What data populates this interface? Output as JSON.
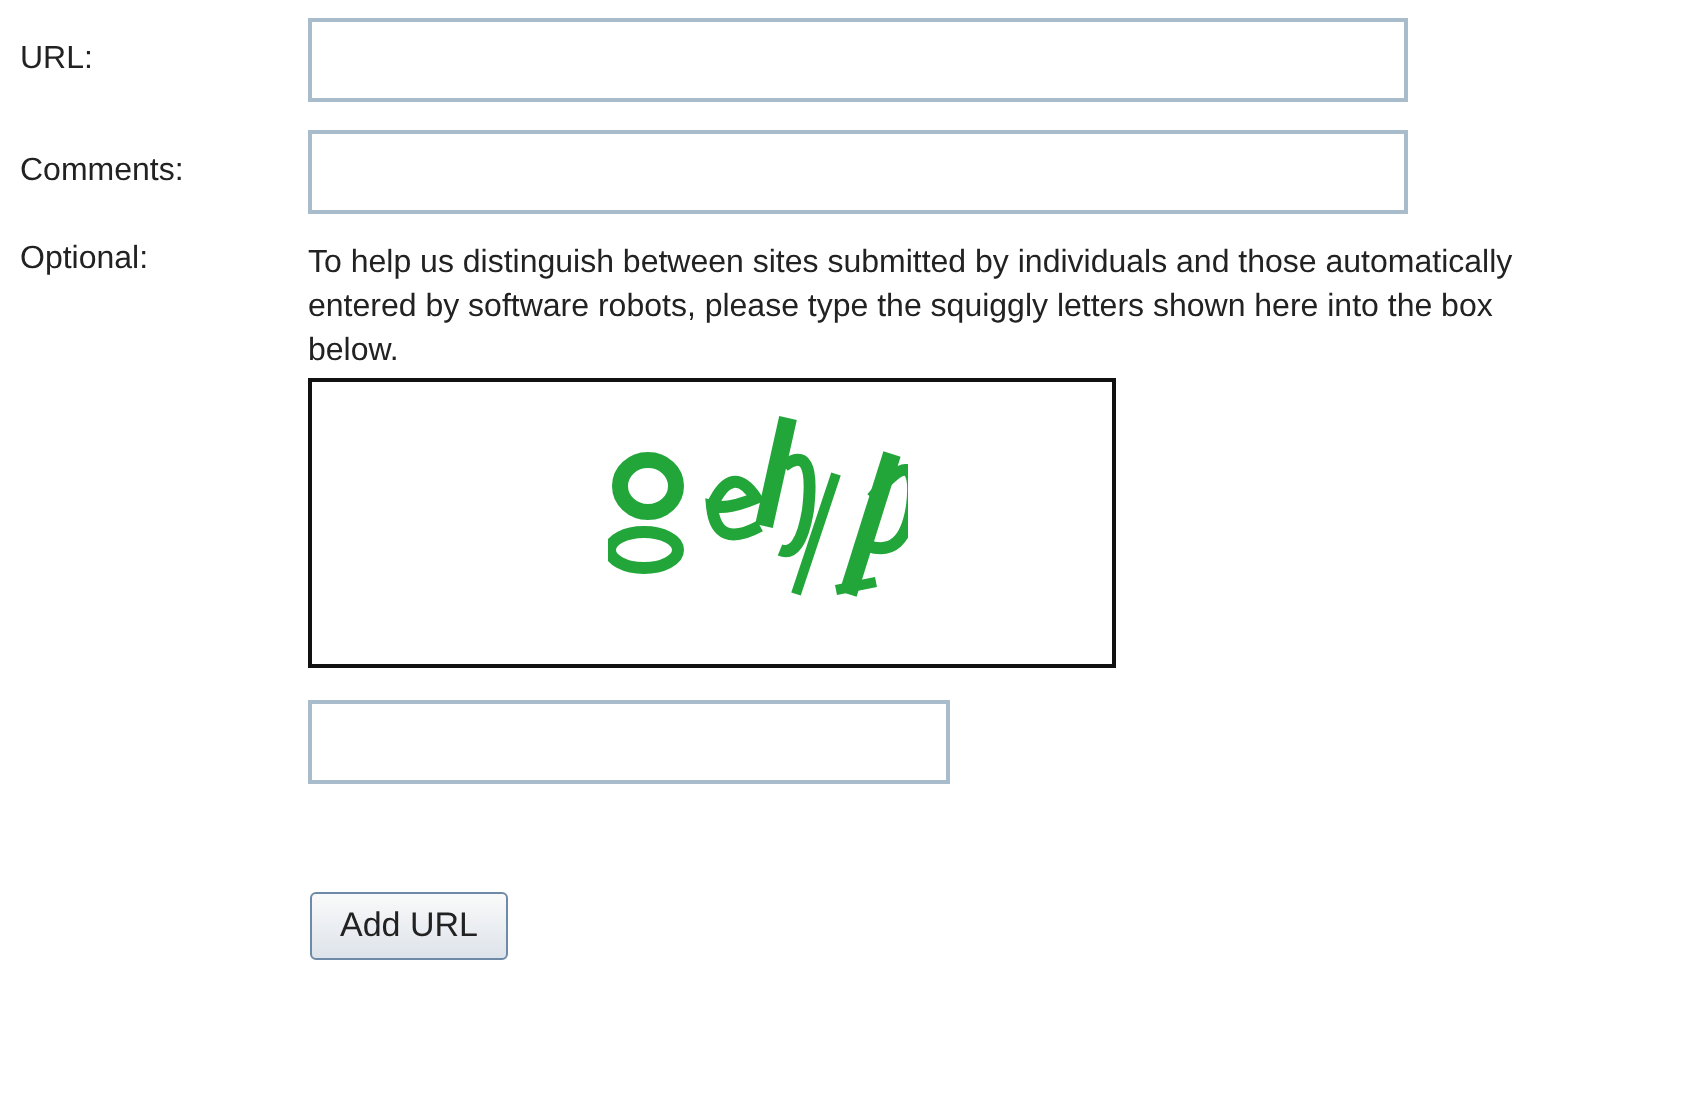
{
  "fields": [
    {
      "label": "URL:",
      "kind": "input"
    },
    {
      "label": "Comments:",
      "kind": "input"
    }
  ],
  "optional": {
    "label": "Optional:",
    "text": "To help us distinguish between sites submitted by individuals and those automatically entered by software robots, please type the squiggly letters shown here into the box below."
  },
  "button": "Add URL"
}
